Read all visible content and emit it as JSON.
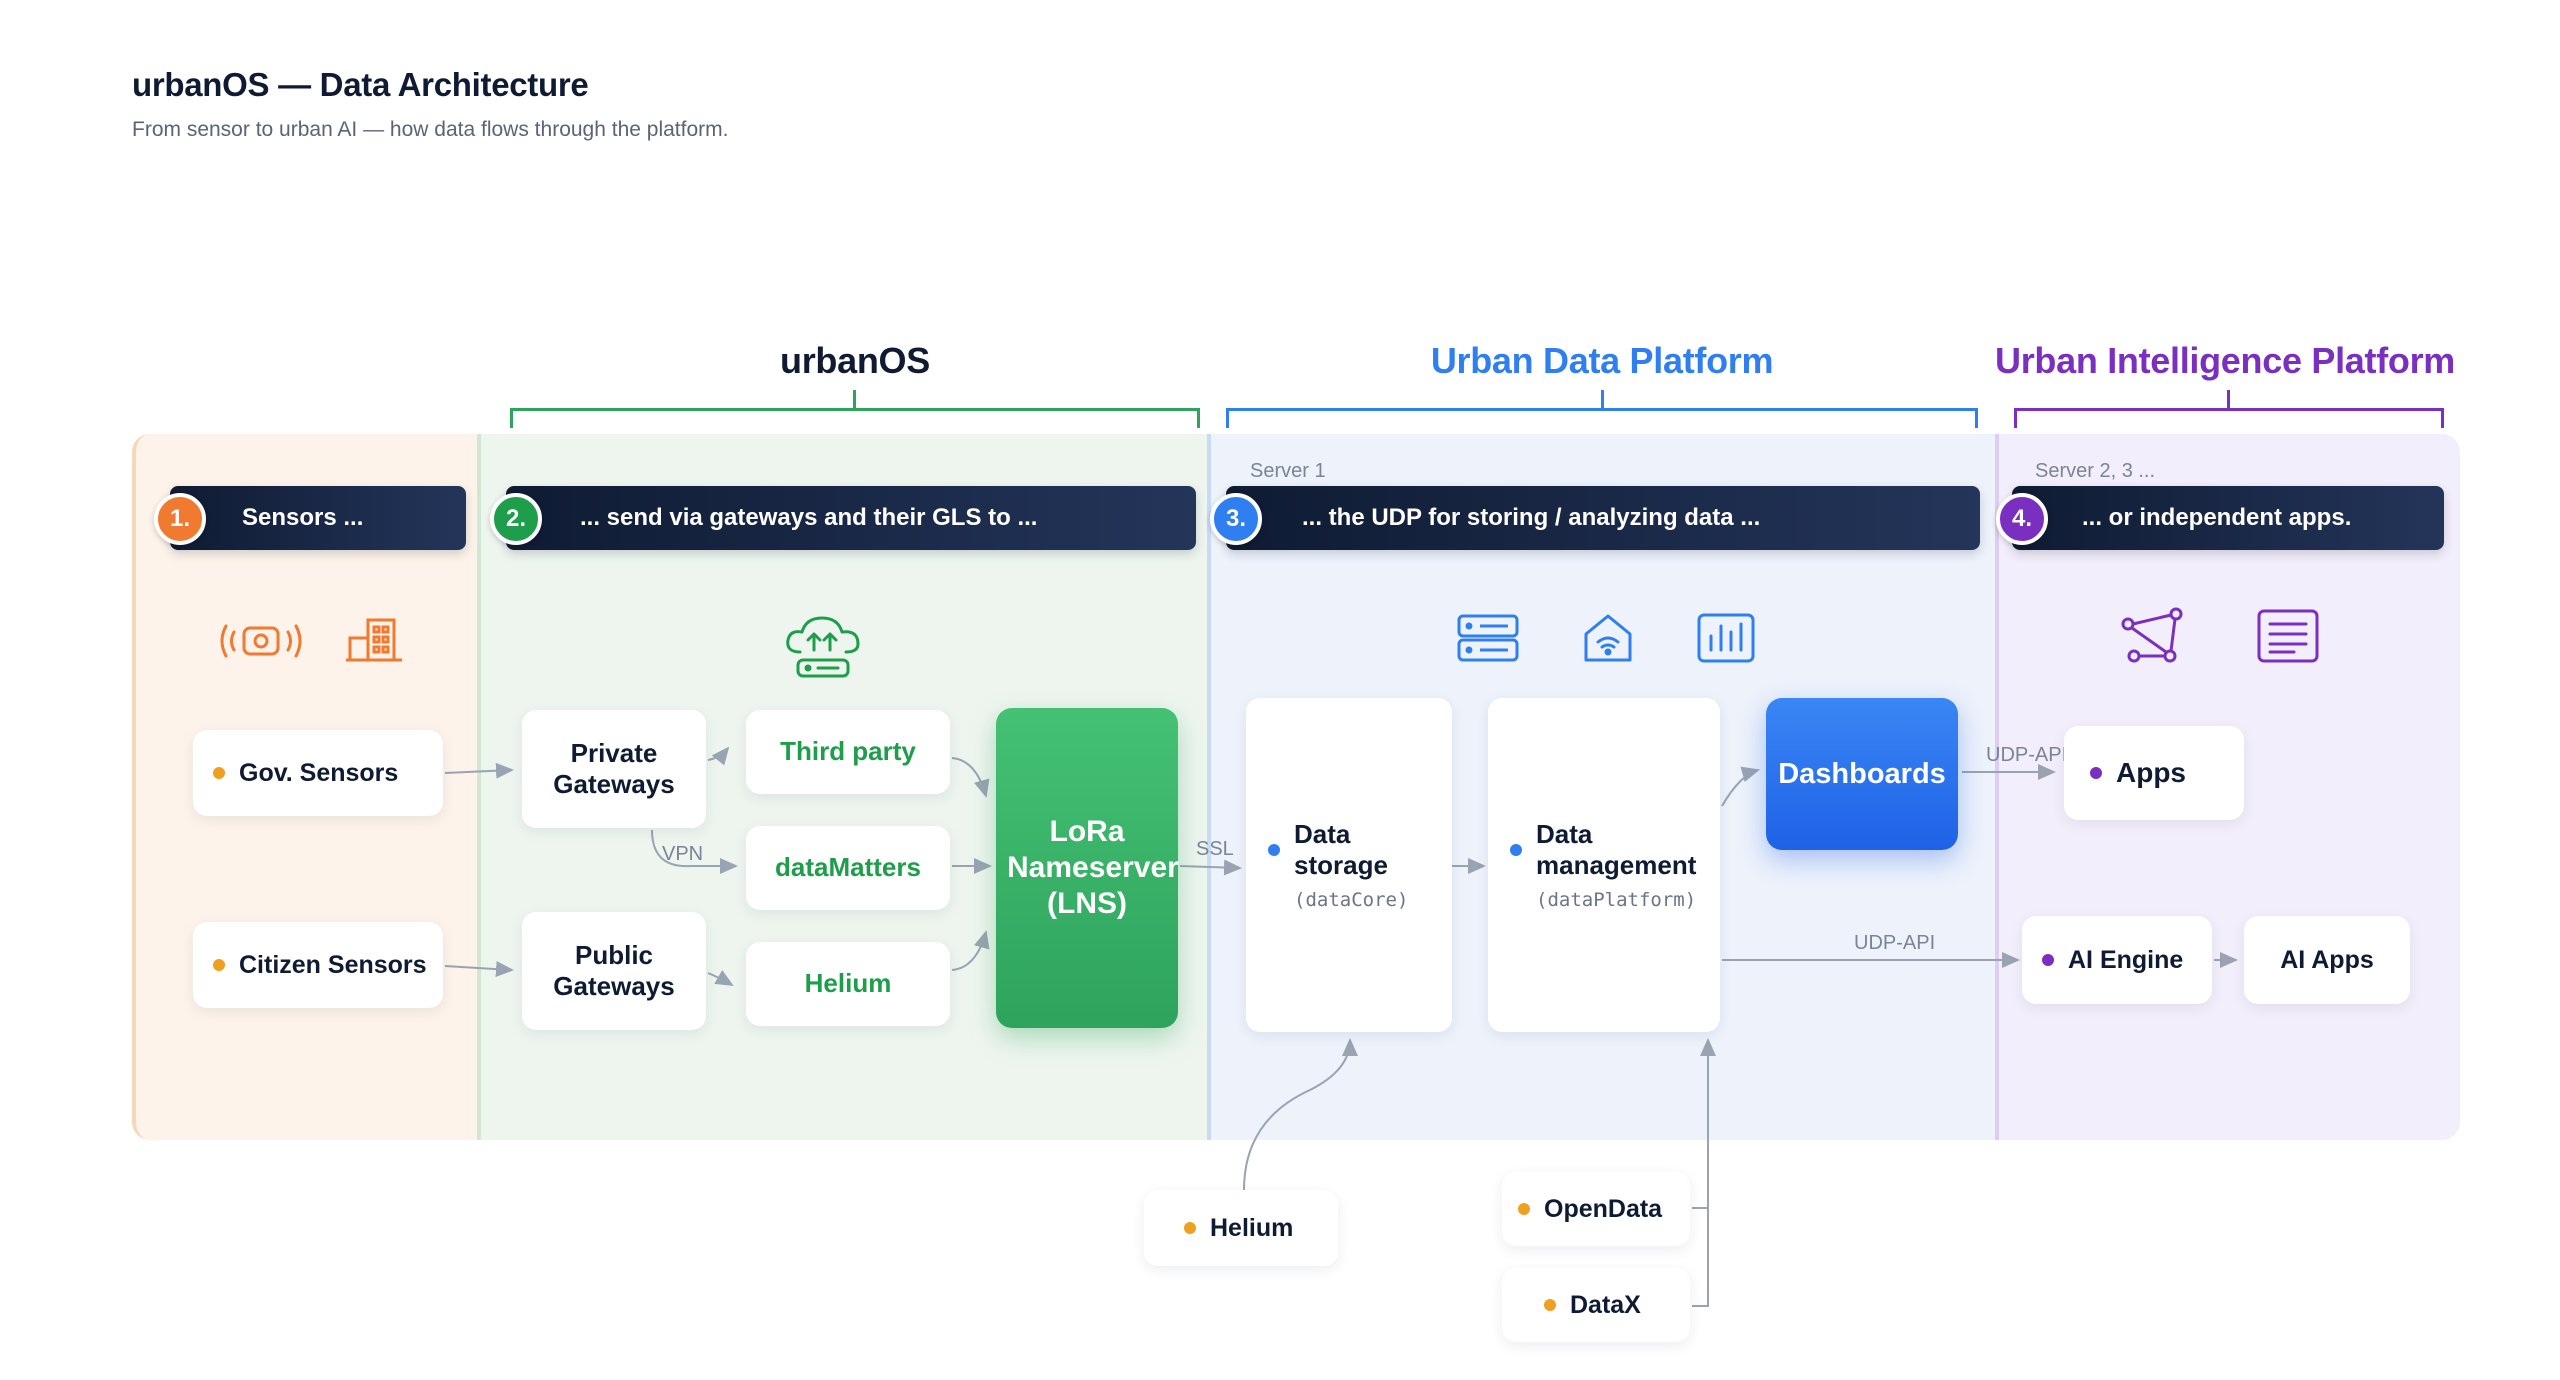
{
  "header": {
    "title": "urbanOS — Data Architecture",
    "subtitle": "From sensor to urban AI — how data flows through the platform."
  },
  "sections": {
    "urbanos": "urbanOS",
    "udp": "Urban Data Platform",
    "uip": "Urban Intelligence Platform"
  },
  "colors": {
    "orange": "#f07a30",
    "green": "#1e9e4a",
    "blue": "#2f7ff0",
    "purple": "#7b2fc0",
    "yellow_dot": "#f0a020",
    "dark": "#0f1b33"
  },
  "steps": [
    {
      "num": "1.",
      "text": "Sensors ..."
    },
    {
      "num": "2.",
      "text": "... send via gateways and their GLS to ..."
    },
    {
      "num": "3.",
      "text": "... the UDP for storing / analyzing data ...",
      "server": "Server 1"
    },
    {
      "num": "4.",
      "text": "... or independent apps.",
      "server": "Server 2, 3 ..."
    }
  ],
  "icons": {
    "sensors": [
      "sensor-signal-icon",
      "building-icon"
    ],
    "urbanos": [
      "cloud-gateway-icon"
    ],
    "udp": [
      "server-icon",
      "home-wifi-icon",
      "bar-chart-icon"
    ],
    "uip": [
      "network-graph-icon",
      "document-list-icon"
    ]
  },
  "nodes": {
    "gov_sensors": "Gov. Sensors",
    "citizen_sensors": "Citizen Sensors",
    "private_gateways": "Private Gateways",
    "public_gateways": "Public Gateways",
    "third_party": "Third party",
    "datamatters": "dataMatters",
    "helium_gls": "Helium",
    "lns": "LoRa Nameserver (LNS)",
    "data_storage": "Data storage",
    "data_storage_sub": "(dataCore)",
    "data_management": "Data management",
    "data_management_sub": "(dataPlatform)",
    "dashboards": "Dashboards",
    "apps": "Apps",
    "ai_engine": "AI Engine",
    "ai_apps": "AI Apps",
    "helium_ext": "Helium",
    "opendata": "OpenData",
    "datax": "DataX"
  },
  "edge_labels": {
    "vpn": "VPN",
    "ssl": "SSL",
    "udp_api_1": "UDP-API",
    "udp_api_2": "UDP-API"
  }
}
